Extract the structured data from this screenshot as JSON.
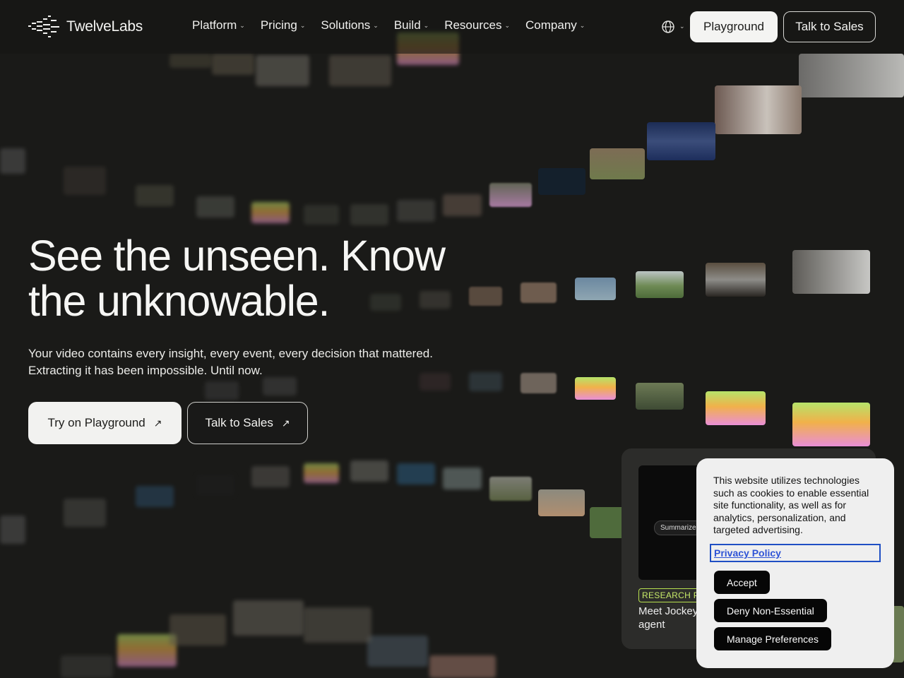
{
  "header": {
    "logo_text": "TwelveLabs",
    "nav": [
      {
        "label": "Platform"
      },
      {
        "label": "Pricing"
      },
      {
        "label": "Solutions"
      },
      {
        "label": "Build"
      },
      {
        "label": "Resources"
      },
      {
        "label": "Company"
      }
    ],
    "playground_label": "Playground",
    "sales_label": "Talk to Sales",
    "language_icon": "globe-icon"
  },
  "hero": {
    "title_line1": "See the unseen. Know",
    "title_line2": "the unknowable.",
    "subtitle_line1": "Your video contains every insight, every event, every decision that mattered.",
    "subtitle_line2": "Extracting it has been impossible. Until now.",
    "cta_primary": "Try on Playground",
    "cta_secondary": "Talk to Sales"
  },
  "research_card": {
    "pill_text": "Summarize",
    "badge": "RESEARCH P",
    "title": "Meet Jockey agent"
  },
  "cookie": {
    "text": "This website utilizes technologies such as cookies to enable essential site functionality, as well as for analytics, personalization, and targeted advertising.",
    "privacy_link": "Privacy Policy",
    "accept": "Accept",
    "deny": "Deny Non-Essential",
    "manage": "Manage Preferences"
  },
  "colors": {
    "background": "#1a1a18",
    "accent_green": "#b7e04f",
    "link_blue": "#2f54d6"
  }
}
